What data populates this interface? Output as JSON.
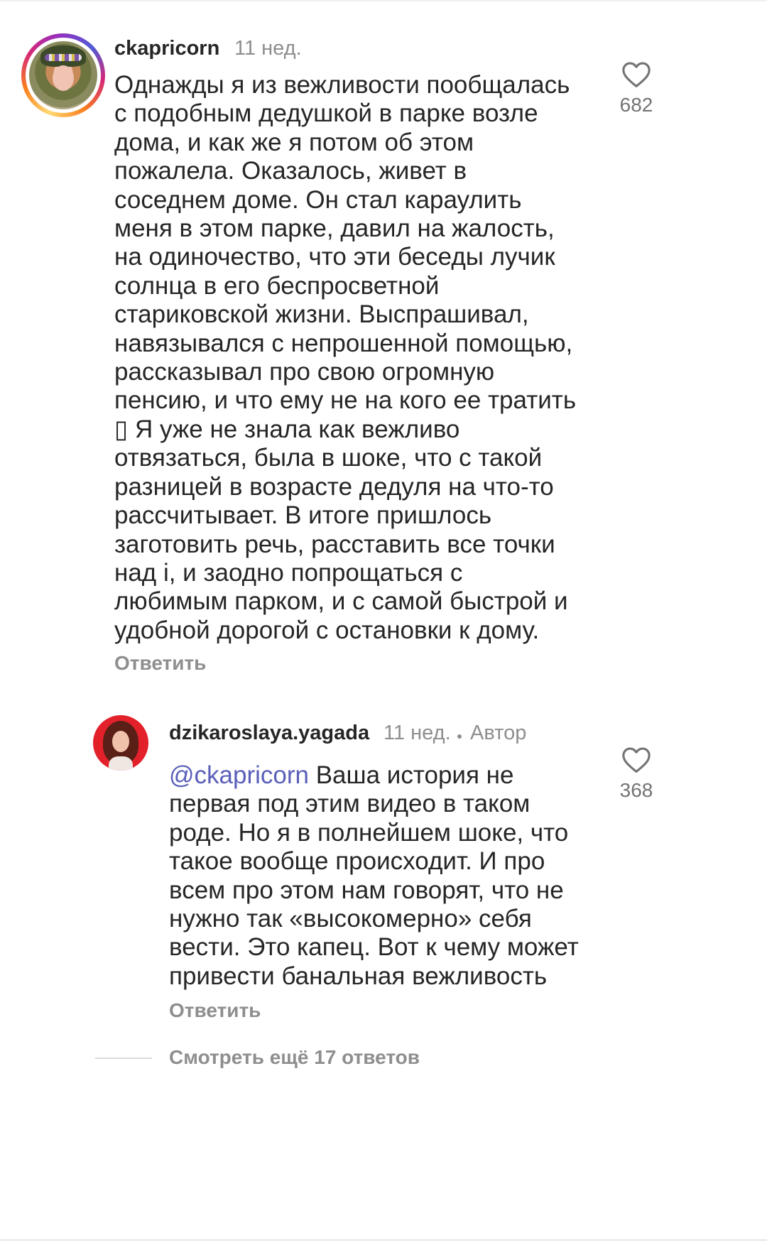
{
  "comments": [
    {
      "username": "ckapricorn",
      "time": "11 нед.",
      "text": "Однажды я из вежливости пообщалась\nс подобным дедушкой в парке возле\nдома, и как же я потом об этом\nпожалела. Оказалось, живет в\nсоседнем доме. Он стал караулить\nменя в этом парке, давил на жалость,\nна одиночество, что эти беседы лучик\nсолнца в его беспросветной\nстариковской жизни. Выспрашивал,\nнавязывался с непрошенной помощью,\nрассказывал про свою огромную\nпенсию, и что ему не на кого ее тратить\n▯ Я уже не знала как вежливо\nотвязаться,  была в шоке, что с такой\nразницей в возрасте дедуля на что-то\nрассчитывает. В итоге пришлось\nзаготовить речь, расставить все точки\nнад і, и заодно попрощаться с\nлюбимым парком, и с самой быстрой и\nудобной дорогой с остановки к дому.",
      "reply_label": "Ответить",
      "likes": "682",
      "like_icon": "heart-outline-icon"
    },
    {
      "username": "dzikaroslaya.yagada",
      "time": "11 нед.",
      "author_label": "Автор",
      "mention": "@ckapricorn",
      "text": " Ваша история не\nпервая под этим видео в таком\nроде. Но я в полнейшем шоке, что\nтакое вообще происходит. И про\nвсем про этом нам говорят, что не\nнужно так «высокомерно» себя\nвести. Это капец. Вот к чему может\nпривести банальная вежливость",
      "reply_label": "Ответить",
      "likes": "368",
      "like_icon": "heart-outline-icon"
    }
  ],
  "view_more_label": "Смотреть ещё 17 ответов",
  "colors": {
    "text": "#262626",
    "secondary": "#8e8e8e",
    "mention": "#5a5fb9"
  }
}
